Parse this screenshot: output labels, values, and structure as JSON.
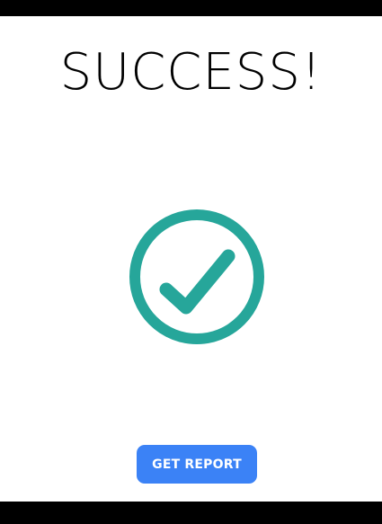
{
  "page": {
    "title": "SUCCESS!"
  },
  "status_icon": {
    "name": "check-circle-icon",
    "color": "#26a69a"
  },
  "actions": {
    "get_report_label": "GET REPORT",
    "button_color": "#3b82f6"
  }
}
